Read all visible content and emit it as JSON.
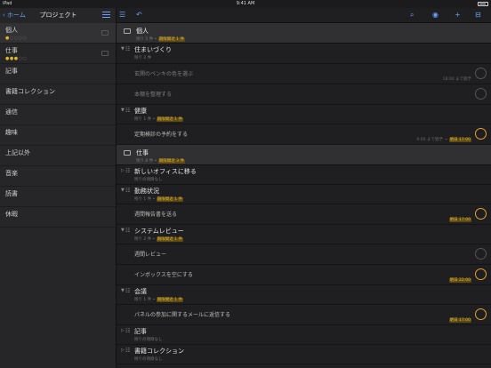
{
  "status": {
    "carrier": "iPad",
    "time": "9:41 AM"
  },
  "sidebar": {
    "back_label": "ホーム",
    "title": "プロジェクト",
    "items": [
      {
        "label": "個人",
        "dots_on": "●",
        "dots_off": "○○○○"
      },
      {
        "label": "仕事",
        "dots_on": "●●●",
        "dots_off": "○○"
      },
      {
        "label": "記事"
      },
      {
        "label": "書籍コレクション"
      },
      {
        "label": "通信"
      },
      {
        "label": "趣味"
      },
      {
        "label": "上記以外"
      },
      {
        "label": "音楽"
      },
      {
        "label": "読書"
      },
      {
        "label": "休暇"
      }
    ]
  },
  "main": {
    "sections": [
      {
        "title": "個人",
        "meta_prefix": "残り 5 件 •",
        "badge": "期限間近 1 件"
      },
      {
        "title": "仕事",
        "meta_prefix": "残り 8 件 •",
        "badge": "期限間近 3 件"
      }
    ],
    "projects": [
      {
        "title": "住まいづくり",
        "meta": "残り 2 件"
      },
      {
        "title": "健康",
        "meta_prefix": "残り 1 件 •",
        "badge": "期限間近 1 件"
      },
      {
        "title": "新しいオフィスに移る",
        "meta": "残りの項目なし"
      },
      {
        "title": "勤務状況",
        "meta_prefix": "残り 1 件 •",
        "badge": "期限間近 1 件"
      },
      {
        "title": "システムレビュー",
        "meta_prefix": "残り 2 件 •",
        "badge": "期限間近 1 件"
      },
      {
        "title": "会議",
        "meta_prefix": "残り 1 件 •",
        "badge": "期限間近 1 件"
      },
      {
        "title": "記事",
        "meta": "残りの項目なし"
      },
      {
        "title": "書籍コレクション",
        "meta": "残りの項目なし"
      }
    ],
    "tasks": [
      {
        "label": "玄関のペンキの色を選ぶ",
        "due": "18:00 まで猶予"
      },
      {
        "label": "本棚を整理する"
      },
      {
        "label": "定期検診の予約をする",
        "due_prefix": "9:00 まで猶予 →",
        "due_badge": "明日 17:00"
      },
      {
        "label": "週間報告書を送る",
        "due_badge": "明日 17:00"
      },
      {
        "label": "週間レビュー"
      },
      {
        "label": "インボックスを空にする",
        "due_badge": "明日 22:00"
      },
      {
        "label": "パネルの参加に関するメールに返信する",
        "due_badge": "明日 17:00"
      }
    ]
  },
  "colors": {
    "accent": "#6a9ff5",
    "due": "#e8a22e",
    "badge_text": "#e8b93a"
  },
  "icons": [
    "back-chevron-icon",
    "list-icon",
    "outline-icon",
    "undo-icon",
    "search-icon",
    "eye-icon",
    "plus-icon",
    "inbox-icon",
    "folder-icon",
    "checkbox-circle-icon"
  ]
}
